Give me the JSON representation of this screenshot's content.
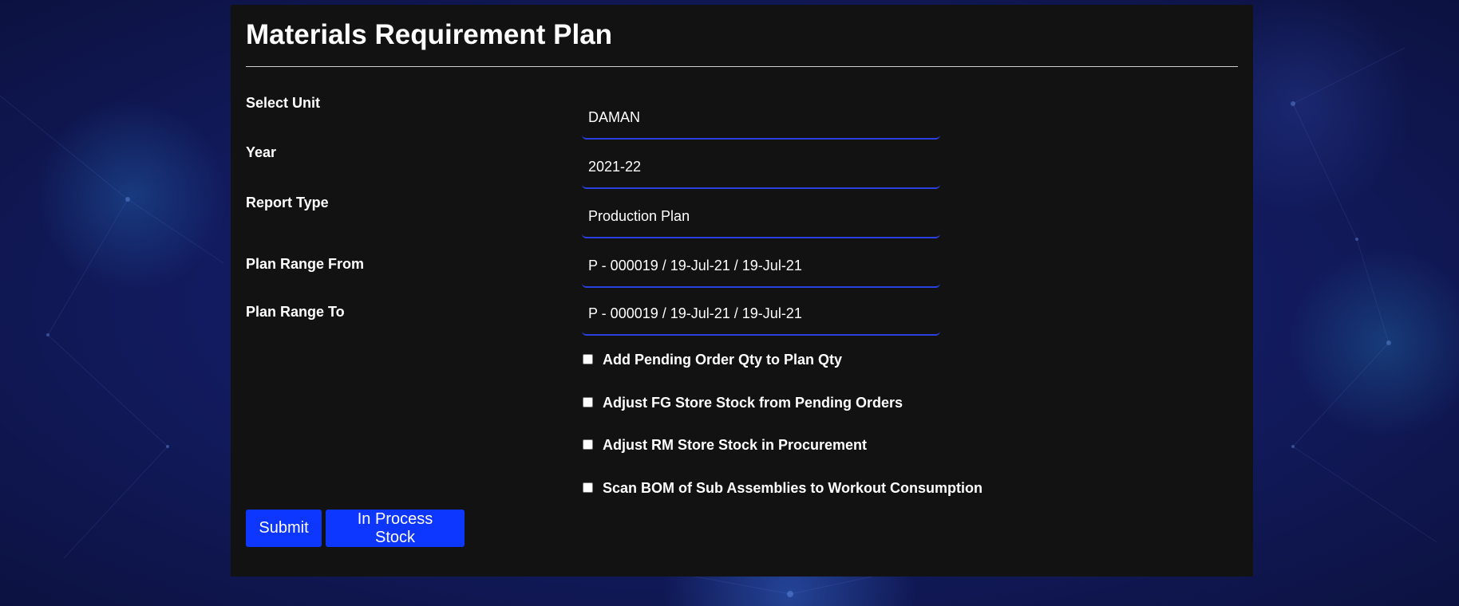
{
  "page": {
    "title": "Materials Requirement Plan"
  },
  "form": {
    "fields": [
      {
        "label": "Select Unit",
        "value": "DAMAN"
      },
      {
        "label": "Year",
        "value": "2021-22"
      },
      {
        "label": "Report Type",
        "value": "Production Plan"
      },
      {
        "label": "Plan Range From",
        "value": "P - 000019 / 19-Jul-21 / 19-Jul-21"
      },
      {
        "label": "Plan Range To",
        "value": "P - 000019 / 19-Jul-21 / 19-Jul-21"
      }
    ],
    "checkboxes": [
      {
        "label": "Add Pending Order Qty to Plan Qty",
        "checked": false
      },
      {
        "label": "Adjust FG Store Stock from Pending Orders",
        "checked": false
      },
      {
        "label": "Adjust RM Store Stock in Procurement",
        "checked": false
      },
      {
        "label": "Scan BOM of Sub Assemblies to Workout Consumption",
        "checked": false
      }
    ]
  },
  "actions": {
    "submit_label": "Submit",
    "in_process_stock_label": "In Process Stock"
  },
  "colors": {
    "panel_background": "#121212",
    "accent_button": "#0d36ff",
    "field_underline": "#2a40e0",
    "page_background": "#131c63"
  }
}
